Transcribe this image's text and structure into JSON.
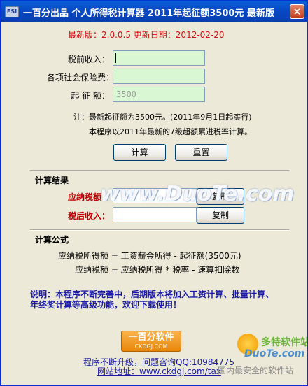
{
  "window": {
    "title": "一百分出品  个人所得税计算器  2011年起征额3500元  最新版",
    "icon_label": "FSI",
    "close_glyph": "×"
  },
  "version_line": "最新版：2.0.0.5   更新日期：2012-02-20",
  "form": {
    "pretax_label": "税前收入：",
    "pretax_value": "",
    "insurance_label": "各项社会保险费：",
    "insurance_value": "",
    "threshold_label": "起 征 额：",
    "threshold_value": "3500"
  },
  "notes": {
    "line1": "注：最新起征额为3500元。(2011年9月1日起实行)",
    "line2": "本程序以2011年最新的7级超额累进税率计算。"
  },
  "buttons": {
    "calculate": "计算",
    "reset": "重置",
    "copy1": "复制",
    "copy2": "复制"
  },
  "results": {
    "section_title": "计算结果",
    "tax_label": "应纳税额：",
    "tax_value": "",
    "aftertax_label": "税后收入：",
    "aftertax_value": ""
  },
  "formula": {
    "section_title": "计算公式",
    "line1": "应纳税所得额 = 工资薪金所得 - 起征额(3500元)",
    "line2": "应纳税额 = 应纳税所得 * 税率 - 速算扣除数"
  },
  "footer": {
    "description_line1": "说明：本程序不断完善中，后期版本将加入工资计算、批量计算、",
    "description_line2": "年终奖计算等高级功能，欢迎下载使用！",
    "logo_main": "一百分软件",
    "logo_sub": "CKDGJ.COM",
    "upgrade_link": "程序不断升级，问题咨询QQ:10984775",
    "website_link": "网站地址：www.ckdgj.com/tax"
  },
  "watermarks": {
    "duote": "www.DuoTe.com",
    "site_name": "多特软件站",
    "site_domain": "DuoTe.com",
    "site_slogan": "国内最安全的软件站"
  },
  "colors": {
    "titlebar": "#0846c1",
    "input_bg": "#d9f7d2",
    "red_text": "#d41010",
    "blue_text": "#1a1aa6"
  }
}
